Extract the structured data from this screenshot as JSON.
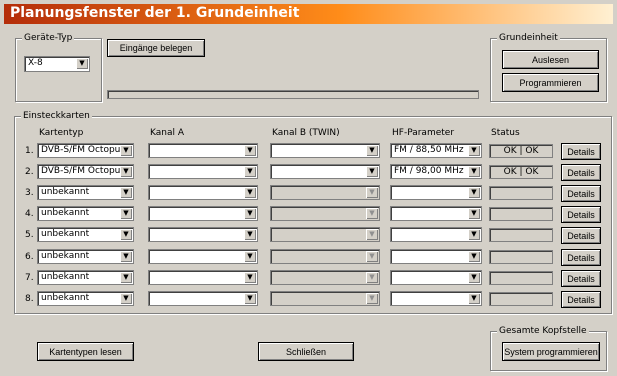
{
  "window": {
    "title": "Planungsfenster der 1. Grundeinheit"
  },
  "geraete": {
    "legend": "Geräte-Typ",
    "selected": "X-8",
    "assign_label": "Eingänge belegen"
  },
  "grundeinheit": {
    "legend": "Grundeinheit",
    "read_label": "Auslesen",
    "program_label": "Programmieren"
  },
  "cards": {
    "legend": "Einsteckkarten",
    "headers": {
      "type": "Kartentyp",
      "a": "Kanal A",
      "b": "Kanal B (TWIN)",
      "hf": "HF-Parameter",
      "status": "Status"
    },
    "details_label": "Details",
    "rows": [
      {
        "num": "1.",
        "type": "DVB-S/FM Octopus",
        "a": "",
        "b": "",
        "hf": "FM / 88,50 MHz",
        "status": "OK | OK",
        "b_enabled": true
      },
      {
        "num": "2.",
        "type": "DVB-S/FM Octopus",
        "a": "",
        "b": "",
        "hf": "FM / 98,00 MHz",
        "status": "OK | OK",
        "b_enabled": true
      },
      {
        "num": "3.",
        "type": "unbekannt",
        "a": "",
        "b": "",
        "hf": "",
        "status": "",
        "b_enabled": false
      },
      {
        "num": "4.",
        "type": "unbekannt",
        "a": "",
        "b": "",
        "hf": "",
        "status": "",
        "b_enabled": false
      },
      {
        "num": "5.",
        "type": "unbekannt",
        "a": "",
        "b": "",
        "hf": "",
        "status": "",
        "b_enabled": false
      },
      {
        "num": "6.",
        "type": "unbekannt",
        "a": "",
        "b": "",
        "hf": "",
        "status": "",
        "b_enabled": false
      },
      {
        "num": "7.",
        "type": "unbekannt",
        "a": "",
        "b": "",
        "hf": "",
        "status": "",
        "b_enabled": false
      },
      {
        "num": "8.",
        "type": "unbekannt",
        "a": "",
        "b": "",
        "hf": "",
        "status": "",
        "b_enabled": false
      }
    ]
  },
  "footer": {
    "read_types_label": "Kartentypen lesen",
    "close_label": "Schließen"
  },
  "kopfstelle": {
    "legend": "Gesamte Kopfstelle",
    "program_label": "System programmieren"
  }
}
